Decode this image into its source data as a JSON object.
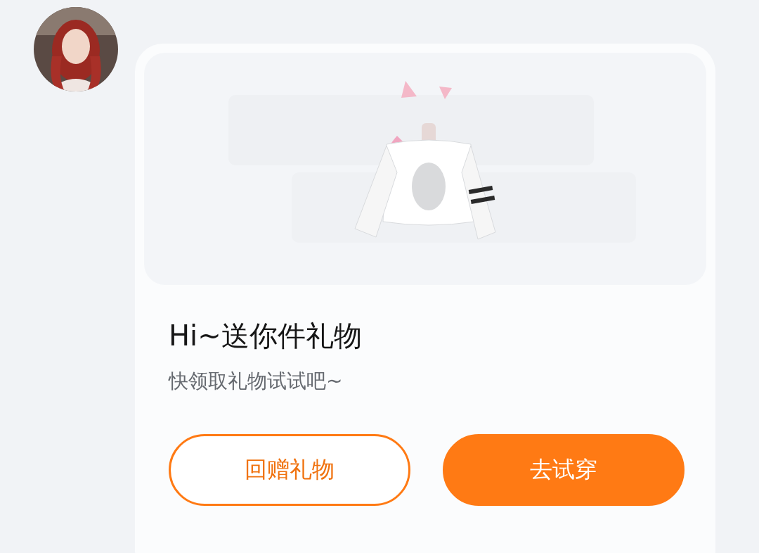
{
  "card": {
    "title": "Hi~送你件礼物",
    "subtitle": "快领取礼物试试吧~",
    "buttons": [
      {
        "label": "回赠礼物",
        "kind": "outline"
      },
      {
        "label": "去试穿",
        "kind": "primary"
      }
    ]
  }
}
